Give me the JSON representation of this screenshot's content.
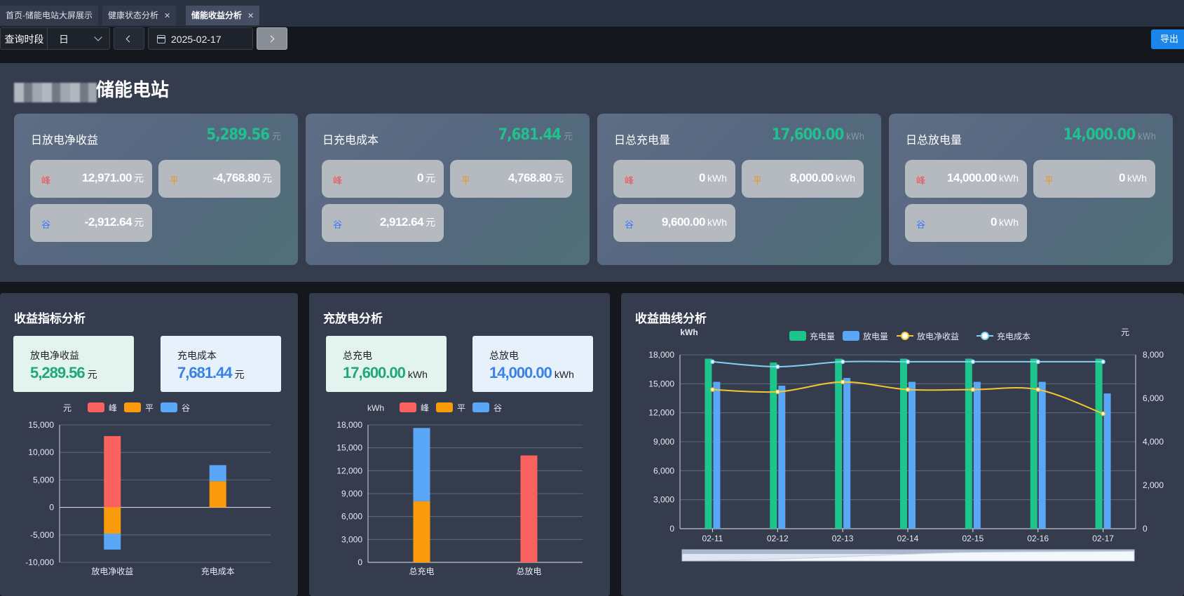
{
  "tabs": [
    {
      "label": "首页-储能电站大屏展示",
      "closable": false
    },
    {
      "label": "健康状态分析",
      "closable": true
    },
    {
      "label": "储能收益分析",
      "closable": true,
      "active": true
    }
  ],
  "toolbar": {
    "period_label": "查询时段",
    "period_value": "日",
    "date_value": "2025-02-17",
    "export_label": "导出"
  },
  "station": {
    "title_suffix": "储能电站",
    "cards": [
      {
        "title": "日放电净收益",
        "total": "5,289.56",
        "unit": "元",
        "items": [
          {
            "k": "峰",
            "v": "12,971.00",
            "u": "元"
          },
          {
            "k": "平",
            "v": "-4,768.80",
            "u": "元"
          },
          {
            "k": "谷",
            "v": "-2,912.64",
            "u": "元"
          }
        ]
      },
      {
        "title": "日充电成本",
        "total": "7,681.44",
        "unit": "元",
        "items": [
          {
            "k": "峰",
            "v": "0",
            "u": "元"
          },
          {
            "k": "平",
            "v": "4,768.80",
            "u": "元"
          },
          {
            "k": "谷",
            "v": "2,912.64",
            "u": "元"
          }
        ]
      },
      {
        "title": "日总充电量",
        "total": "17,600.00",
        "unit": "kWh",
        "items": [
          {
            "k": "峰",
            "v": "0",
            "u": "kWh"
          },
          {
            "k": "平",
            "v": "8,000.00",
            "u": "kWh"
          },
          {
            "k": "谷",
            "v": "9,600.00",
            "u": "kWh"
          }
        ]
      },
      {
        "title": "日总放电量",
        "total": "14,000.00",
        "unit": "kWh",
        "items": [
          {
            "k": "峰",
            "v": "14,000.00",
            "u": "kWh"
          },
          {
            "k": "平",
            "v": "0",
            "u": "kWh"
          },
          {
            "k": "谷",
            "v": "0",
            "u": "kWh"
          }
        ]
      }
    ]
  },
  "revenue_panel": {
    "title": "收益指标分析",
    "stats": [
      {
        "label": "放电净收益",
        "value": "5,289.56",
        "unit": "元"
      },
      {
        "label": "充电成本",
        "value": "7,681.44",
        "unit": "元"
      }
    ]
  },
  "charge_panel": {
    "title": "充放电分析",
    "stats": [
      {
        "label": "总充电",
        "value": "17,600.00",
        "unit": "kWh"
      },
      {
        "label": "总放电",
        "value": "14,000.00",
        "unit": "kWh"
      }
    ]
  },
  "curve_panel": {
    "title": "收益曲线分析"
  },
  "colors": {
    "peak": "#f9625f",
    "flat": "#fa9b0b",
    "valley": "#5aa7f7",
    "charge": "#1dc48c",
    "discharge": "#5aa7f7",
    "net": "#f4c630",
    "cost": "#7fd3f0"
  },
  "chart_data": [
    {
      "type": "bar",
      "stacked": true,
      "ylabel": "元",
      "categories": [
        "放电净收益",
        "充电成本"
      ],
      "ylim": [
        -10000,
        15000
      ],
      "yticks": [
        -10000,
        -5000,
        0,
        5000,
        10000,
        15000
      ],
      "series": [
        {
          "name": "峰",
          "values": [
            12971.0,
            0
          ]
        },
        {
          "name": "平",
          "values": [
            -4768.8,
            4768.8
          ]
        },
        {
          "name": "谷",
          "values": [
            -2912.64,
            2912.64
          ]
        }
      ],
      "legend": "top"
    },
    {
      "type": "bar",
      "stacked": true,
      "ylabel": "kWh",
      "categories": [
        "总充电",
        "总放电"
      ],
      "ylim": [
        0,
        18000
      ],
      "yticks": [
        0,
        3000,
        6000,
        9000,
        12000,
        15000,
        18000
      ],
      "series": [
        {
          "name": "峰",
          "values": [
            0,
            14000
          ]
        },
        {
          "name": "平",
          "values": [
            8000,
            0
          ]
        },
        {
          "name": "谷",
          "values": [
            9600,
            0
          ]
        }
      ],
      "legend": "top"
    },
    {
      "type": "bar+line",
      "ylabel": "kWh",
      "y2label": "元",
      "categories": [
        "02-11",
        "02-12",
        "02-13",
        "02-14",
        "02-15",
        "02-16",
        "02-17"
      ],
      "ylim": [
        0,
        18000
      ],
      "yticks": [
        0,
        3000,
        6000,
        9000,
        12000,
        15000,
        18000
      ],
      "y2lim": [
        0,
        8000
      ],
      "y2ticks": [
        0,
        2000,
        4000,
        6000,
        8000
      ],
      "series": [
        {
          "name": "充电量",
          "type": "bar",
          "axis": "left",
          "values": [
            17600,
            17200,
            17600,
            17600,
            17600,
            17600,
            17600
          ]
        },
        {
          "name": "放电量",
          "type": "bar",
          "axis": "left",
          "values": [
            15200,
            14800,
            15600,
            15200,
            15200,
            15200,
            14000
          ]
        },
        {
          "name": "放电净收益",
          "type": "line",
          "axis": "right",
          "values": [
            6400,
            6300,
            6750,
            6400,
            6400,
            6400,
            5290
          ]
        },
        {
          "name": "充电成本",
          "type": "line",
          "axis": "right",
          "values": [
            7680,
            7450,
            7680,
            7680,
            7680,
            7680,
            7680
          ]
        }
      ],
      "legend": "top"
    }
  ]
}
